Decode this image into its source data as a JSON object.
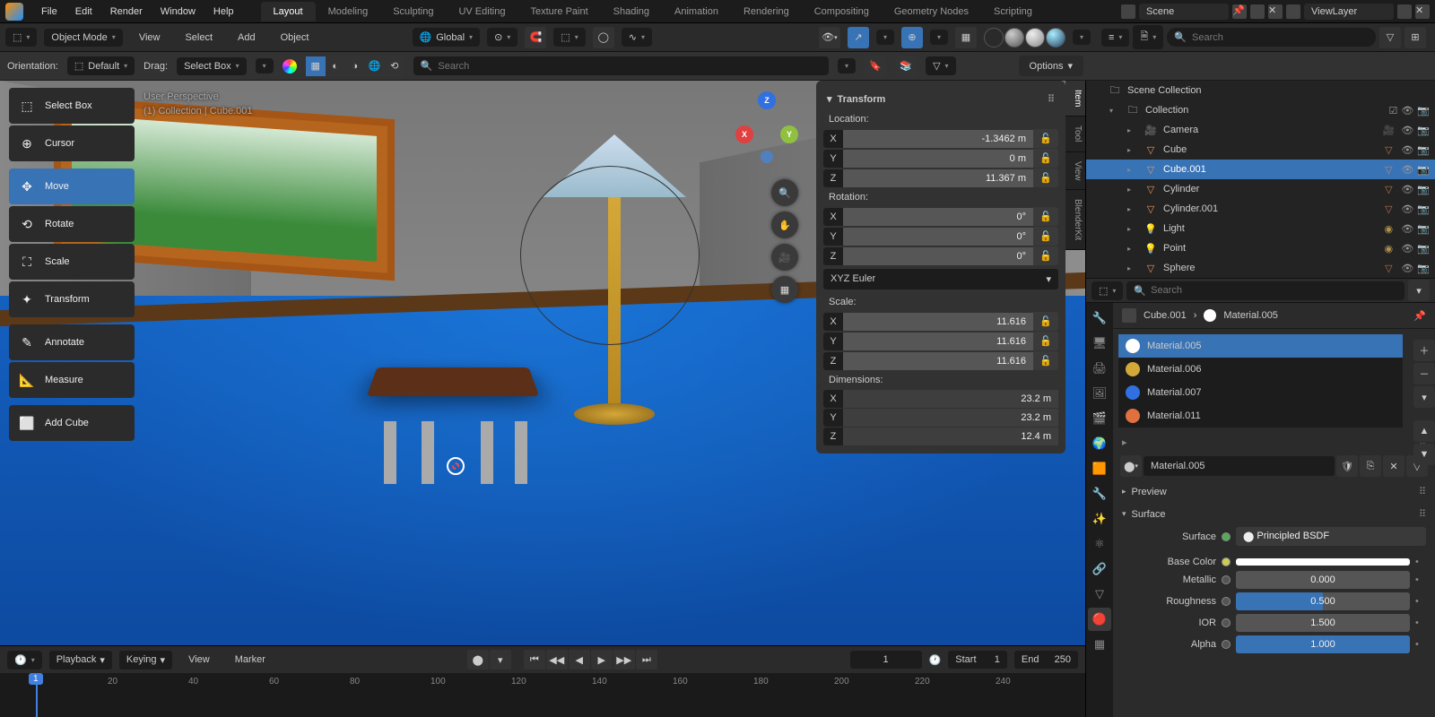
{
  "menu": {
    "items": [
      "File",
      "Edit",
      "Render",
      "Window",
      "Help"
    ]
  },
  "workspace_tabs": [
    "Layout",
    "Modeling",
    "Sculpting",
    "UV Editing",
    "Texture Paint",
    "Shading",
    "Animation",
    "Rendering",
    "Compositing",
    "Geometry Nodes",
    "Scripting"
  ],
  "scene_field": "Scene",
  "layer_field": "ViewLayer",
  "header": {
    "mode": "Object Mode",
    "menus": [
      "View",
      "Select",
      "Add",
      "Object"
    ],
    "orientation": "Global"
  },
  "subheader": {
    "orientation_lbl": "Orientation:",
    "orientation_val": "Default",
    "drag_lbl": "Drag:",
    "drag_val": "Select Box",
    "search_ph": "Search",
    "options": "Options"
  },
  "toolbar": [
    "Select Box",
    "Cursor",
    "Move",
    "Rotate",
    "Scale",
    "Transform",
    "Annotate",
    "Measure",
    "Add Cube"
  ],
  "overlay": {
    "l1": "User Perspective",
    "l2": "(1) Collection | Cube.001"
  },
  "npanel": {
    "title": "Transform",
    "loc_lbl": "Location:",
    "loc": {
      "x": "-1.3462 m",
      "y": "0 m",
      "z": "11.367 m"
    },
    "rot_lbl": "Rotation:",
    "rot": {
      "x": "0°",
      "y": "0°",
      "z": "0°"
    },
    "rot_mode": "XYZ Euler",
    "scale_lbl": "Scale:",
    "scale": {
      "x": "11.616",
      "y": "11.616",
      "z": "11.616"
    },
    "dim_lbl": "Dimensions:",
    "dim": {
      "x": "23.2 m",
      "y": "23.2 m",
      "z": "12.4 m"
    }
  },
  "sidetabs": [
    "Item",
    "Tool",
    "View",
    "BlenderKit"
  ],
  "outliner": {
    "search_ph": "Search",
    "root": "Scene Collection",
    "collection": "Collection",
    "items": [
      {
        "name": "Camera",
        "type": "camera"
      },
      {
        "name": "Cube",
        "type": "mesh"
      },
      {
        "name": "Cube.001",
        "type": "mesh",
        "selected": true
      },
      {
        "name": "Cylinder",
        "type": "mesh"
      },
      {
        "name": "Cylinder.001",
        "type": "mesh"
      },
      {
        "name": "Light",
        "type": "light"
      },
      {
        "name": "Point",
        "type": "light"
      },
      {
        "name": "Sphere",
        "type": "mesh"
      }
    ]
  },
  "props_search_ph": "Search",
  "breadcrumb": {
    "obj": "Cube.001",
    "mat": "Material.005"
  },
  "materials": [
    {
      "name": "Material.005",
      "color": "#ffffff",
      "selected": true
    },
    {
      "name": "Material.006",
      "color": "#d4a838"
    },
    {
      "name": "Material.007",
      "color": "#3070e0"
    },
    {
      "name": "Material.011",
      "color": "#e07040"
    }
  ],
  "mat_name": "Material.005",
  "panels": {
    "preview": "Preview",
    "surface": "Surface",
    "surface_shader_lbl": "Surface",
    "surface_shader": "Principled BSDF",
    "base_color_lbl": "Base Color",
    "metallic_lbl": "Metallic",
    "metallic": "0.000",
    "roughness_lbl": "Roughness",
    "roughness": "0.500",
    "ior_lbl": "IOR",
    "ior": "1.500",
    "alpha_lbl": "Alpha",
    "alpha": "1.000"
  },
  "timeline": {
    "menus": [
      "Playback",
      "Keying",
      "View",
      "Marker"
    ],
    "cur": "1",
    "start_lbl": "Start",
    "start": "1",
    "end_lbl": "End",
    "end": "250",
    "ticks": [
      "20",
      "40",
      "60",
      "80",
      "100",
      "120",
      "140",
      "160",
      "180",
      "200",
      "220",
      "240"
    ],
    "playhead": "1"
  },
  "outliner_field": "1"
}
